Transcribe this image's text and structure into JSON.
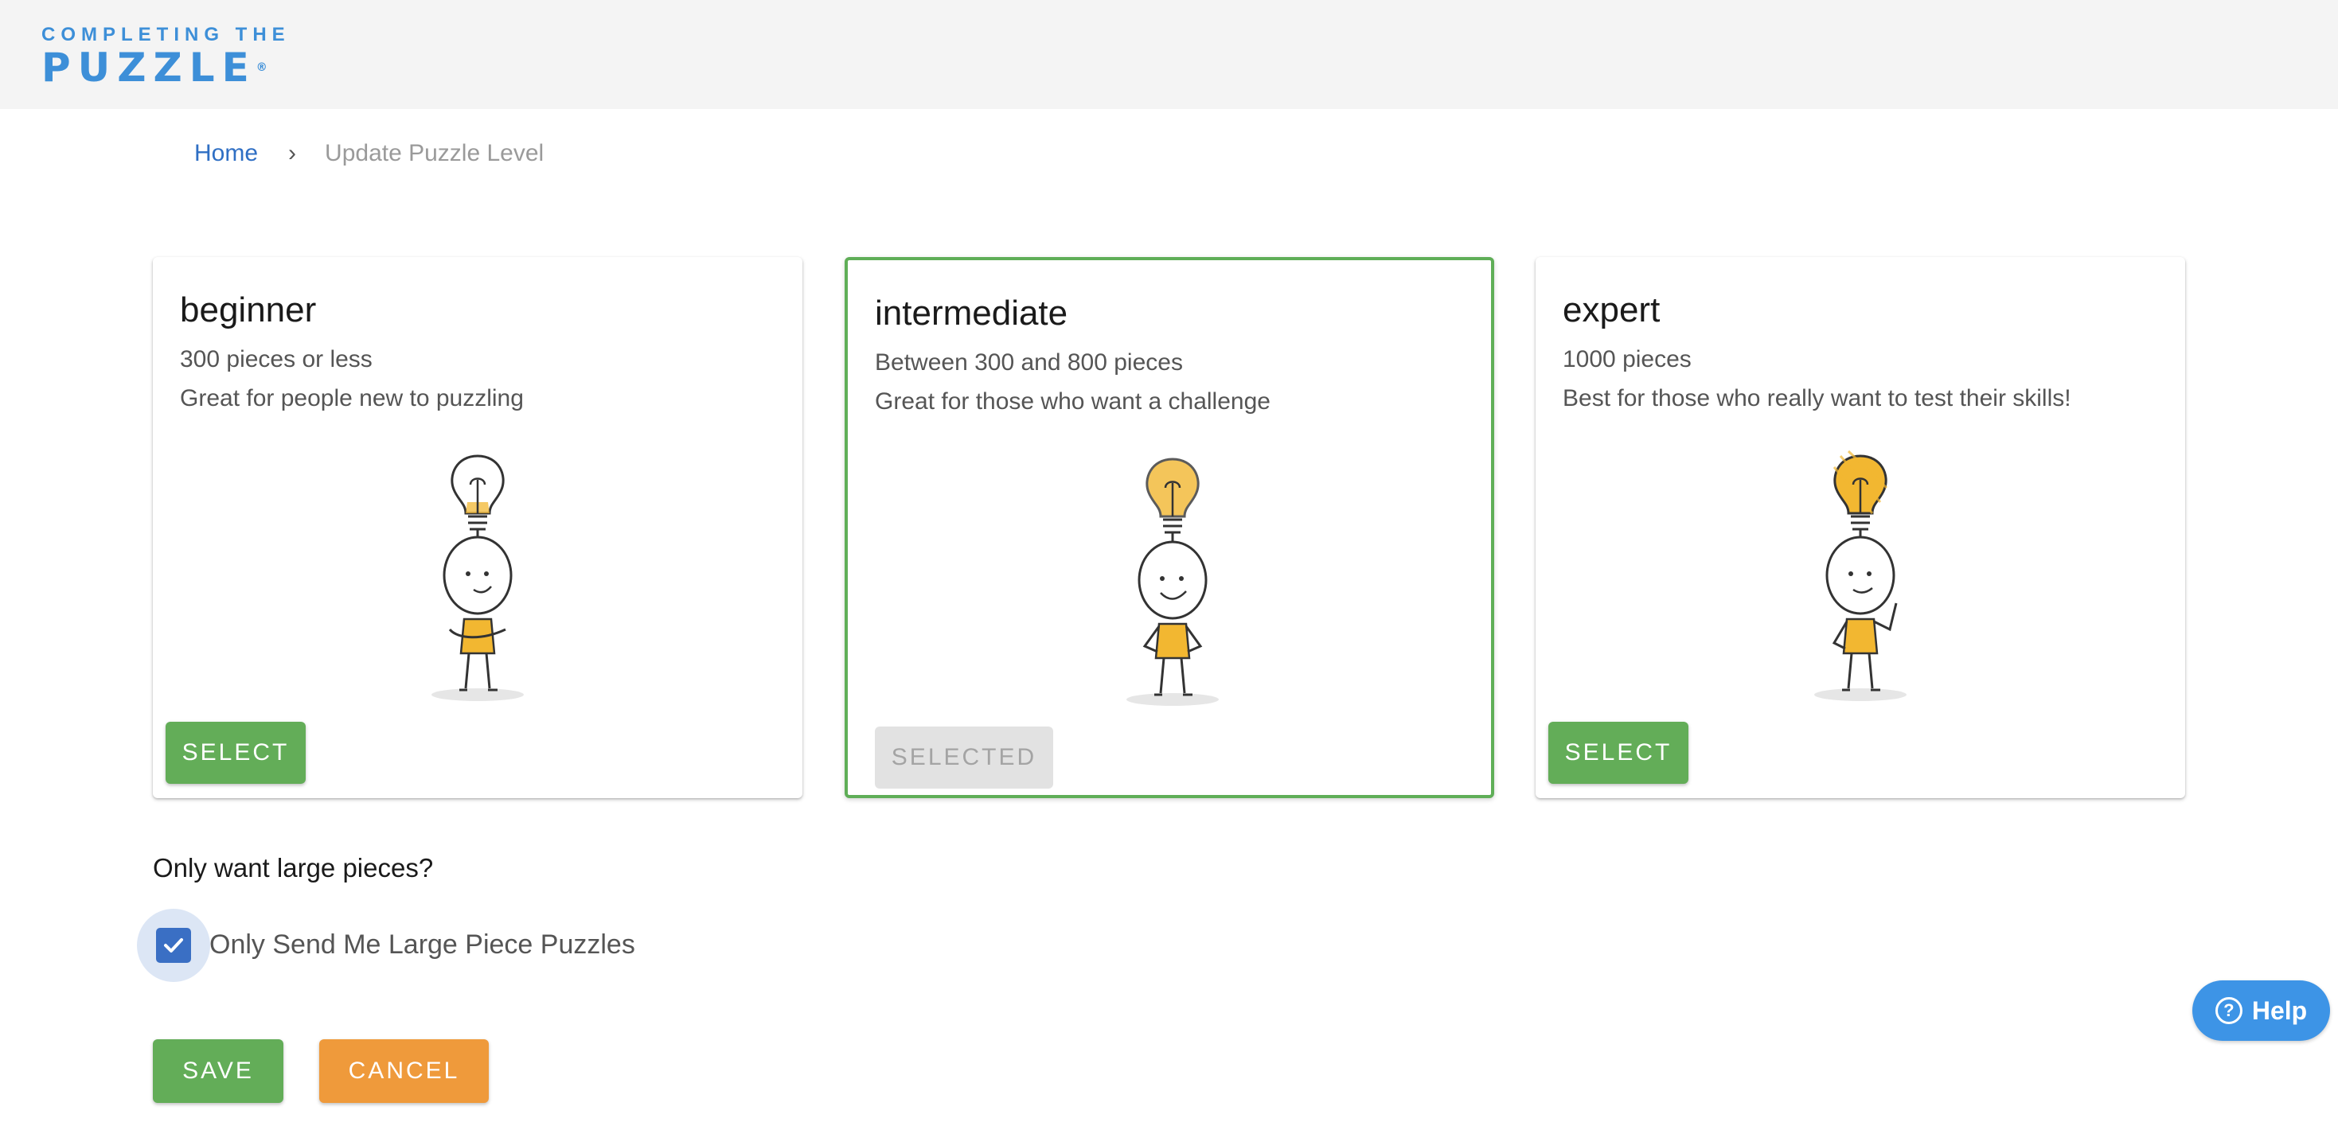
{
  "header": {
    "logo_top": "COMPLETING THE",
    "logo_bottom": "PUZZLE",
    "logo_mark": "®"
  },
  "breadcrumb": {
    "home": "Home",
    "separator": "›",
    "current": "Update Puzzle Level"
  },
  "levels": [
    {
      "title": "beginner",
      "line1": "300 pieces or less",
      "line2": "Great for people new to puzzling",
      "button": "SELECT",
      "selected": false
    },
    {
      "title": "intermediate",
      "line1": "Between 300 and 800 pieces",
      "line2": "Great for those who want a challenge",
      "button": "SELECTED",
      "selected": true
    },
    {
      "title": "expert",
      "line1": "1000 pieces",
      "line2": "Best for those who really want to test their skills!",
      "button": "SELECT",
      "selected": false
    }
  ],
  "large_pieces": {
    "question": "Only want large pieces?",
    "checkbox_label": "Only Send Me Large Piece Puzzles",
    "checked": true
  },
  "actions": {
    "save": "SAVE",
    "cancel": "CANCEL"
  },
  "help": {
    "label": "Help",
    "icon": "?"
  },
  "colors": {
    "brand_blue": "#3d8fd8",
    "link_blue": "#2f6fc4",
    "green": "#63ad58",
    "orange": "#ef9a3b",
    "bulb_yellow": "#f2b731"
  }
}
